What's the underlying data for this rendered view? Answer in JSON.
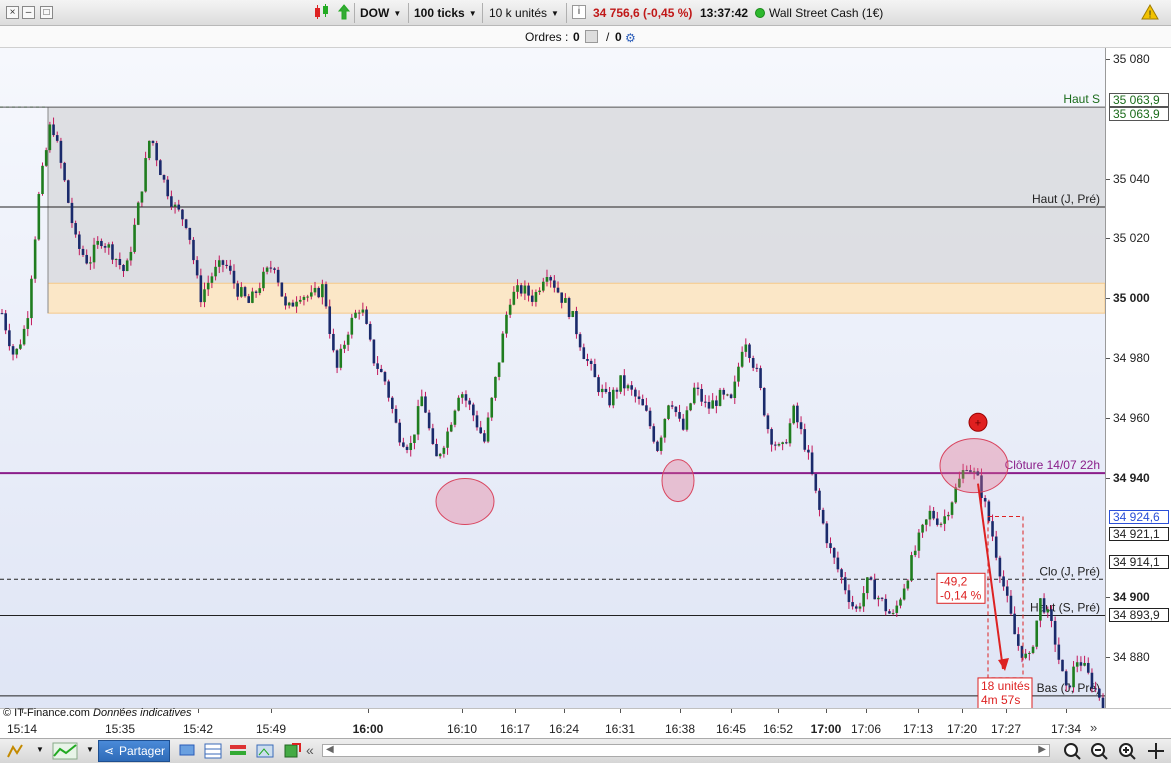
{
  "toolbar": {
    "instrument": "DOW",
    "ticks": "100 ticks",
    "units": "10 k unités",
    "price": "34 756,6 (-0,45 %)",
    "time": "13:37:42",
    "market": "Wall Street Cash (1€)",
    "window_btns": [
      "–",
      "□",
      "×"
    ]
  },
  "orders": {
    "label": "Ordres :",
    "value1": "0",
    "slash": "/",
    "value2": "0"
  },
  "chart_data": {
    "type": "candlestick",
    "yticks": [
      "35 080",
      "35 040",
      "35 020",
      "35 000",
      "34 980",
      "34 960",
      "34 940",
      "34 900",
      "34 880"
    ],
    "ytick_values": [
      35080,
      35040,
      35020,
      35000,
      34980,
      34960,
      34940,
      34900,
      34880
    ],
    "bold_yticks": [
      "35 000",
      "34 940",
      "34 900"
    ],
    "price_boxes": [
      "35 063,9",
      "35 063,9",
      "34 924,6",
      "34 921,1",
      "34 914,1",
      "34 893,9"
    ],
    "price_box_values": [
      35063.9,
      35063.9,
      34924.6,
      34921.1,
      34914.1,
      34893.9
    ],
    "xticks": [
      "15:14",
      "15:35",
      "15:42",
      "15:49",
      "16:00",
      "16:10",
      "16:17",
      "16:24",
      "16:31",
      "16:38",
      "16:45",
      "16:52",
      "17:00",
      "17:06",
      "17:13",
      "17:20",
      "17:27",
      "17:34"
    ],
    "bold_xticks": [
      "16:00",
      "17:00"
    ],
    "levels": [
      {
        "label": "Haut S",
        "value": 35063.9,
        "color": "#1a6b1a"
      },
      {
        "label": "Haut (J, Pré)",
        "value": 35030.5,
        "color": "#222222"
      },
      {
        "label": "Clôture 14/07 22h",
        "value": 34941.5,
        "color": "#8a1d8a"
      },
      {
        "label": "Clo (J, Pré)",
        "value": 34906,
        "color": "#222222"
      },
      {
        "label": "Haut (S, Pré)",
        "value": 34893.9,
        "color": "#222222"
      },
      {
        "label": "Bas (J, Pré)",
        "value": 34867,
        "color": "#222222"
      }
    ],
    "measurement": {
      "change": "-49,2",
      "pct": "-0,14 %",
      "units": "18 unités",
      "duration": "4m 57s"
    },
    "price_path": [
      34995,
      34980,
      34992,
      35035,
      35060,
      35040,
      35018,
      35012,
      35020,
      35015,
      35008,
      35030,
      35055,
      35040,
      35030,
      35025,
      35000,
      35008,
      35012,
      35003,
      34998,
      35006,
      35012,
      34995,
      35002,
      35000,
      35004,
      34975,
      34990,
      34998,
      34980,
      34972,
      34955,
      34950,
      34968,
      34945,
      34955,
      34970,
      34962,
      34952,
      34975,
      35000,
      35003,
      35000,
      35010,
      35002,
      34995,
      34982,
      34972,
      34965,
      34972,
      34968,
      34962,
      34950,
      34968,
      34955,
      34970,
      34963,
      34967,
      34965,
      34988,
      34975,
      34955,
      34948,
      34962,
      34950,
      34930,
      34915,
      34905,
      34895,
      34905,
      34899,
      34893,
      34905,
      34918,
      34928,
      34925,
      34935,
      34945,
      34938,
      34922,
      34903,
      34885,
      34878,
      34900,
      34888,
      34868,
      34880,
      34872,
      34865
    ]
  },
  "footer": {
    "source": "© IT-Finance.com",
    "note": "Données indicatives",
    "share_label": "Partager"
  },
  "colors": {
    "up": "#1f7d1f",
    "down": "#1a2a6b",
    "wick": "#c2185b",
    "purple": "#8a1d8a",
    "zone_orange": "#f5c98a",
    "marker_red": "#e02020"
  }
}
